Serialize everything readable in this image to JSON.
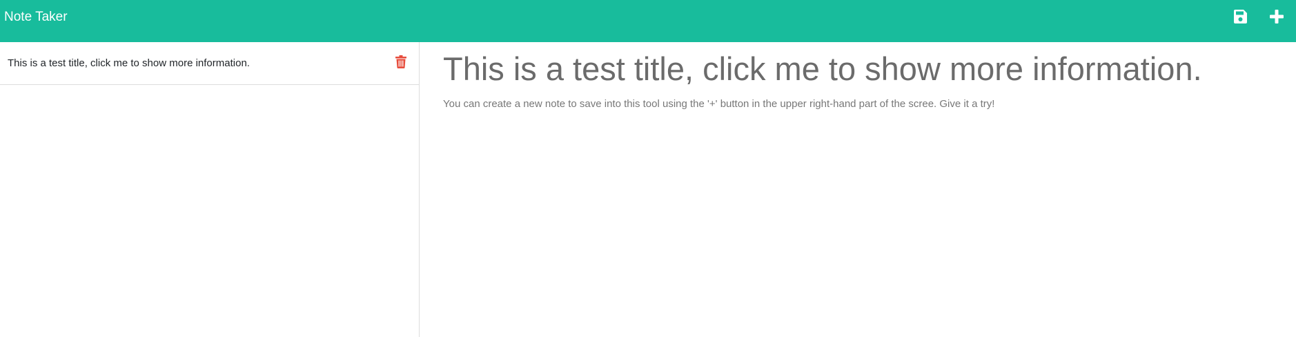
{
  "app": {
    "brand": "Note Taker",
    "colors": {
      "navbar": "#18bc9c",
      "delete": "#e74c3c",
      "title_text": "#6b6b6b",
      "body_text": "#777777"
    }
  },
  "navbar": {
    "save_icon": "save-icon",
    "add_icon": "plus-icon"
  },
  "sidebar": {
    "notes": [
      {
        "title": "This is a test title, click me to show more information.",
        "delete_icon": "trash-icon"
      }
    ]
  },
  "main": {
    "title": "This is a test title, click me to show more information.",
    "text": "You can create a new note to save into this tool using the '+' button in the upper right-hand part of the scree. Give it a try!"
  }
}
